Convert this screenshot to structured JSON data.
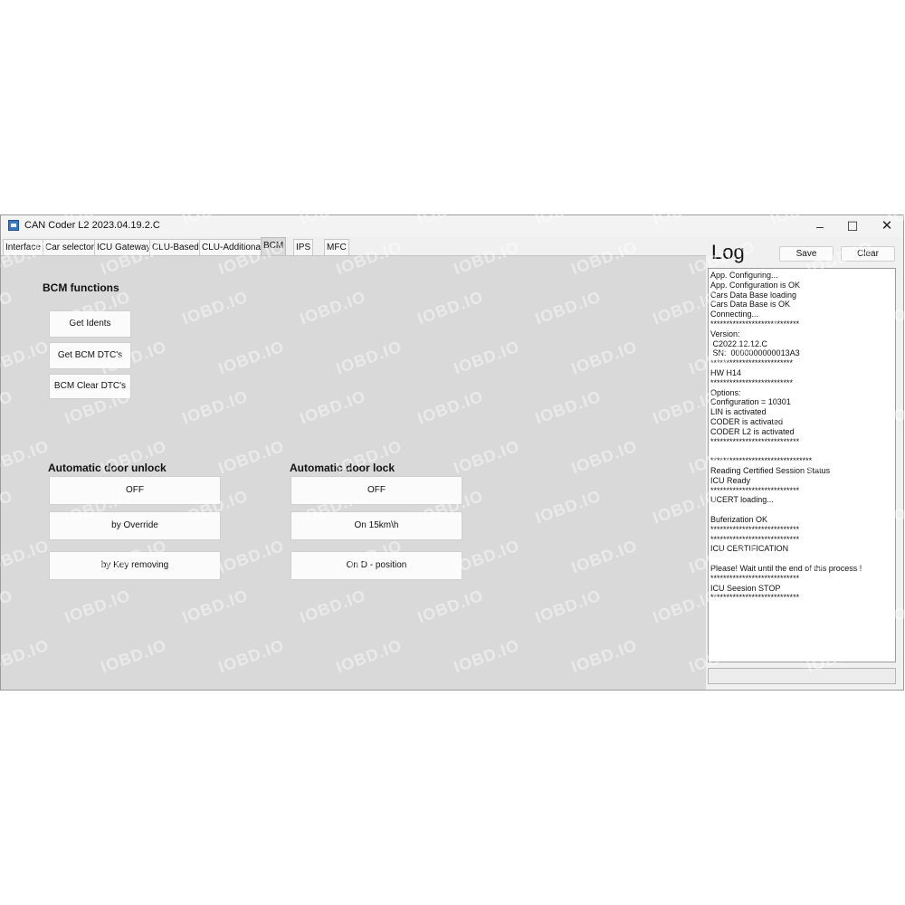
{
  "window": {
    "title": "CAN Coder L2 2023.04.19.2.C",
    "controls": {
      "minimize": "–",
      "maximize": "☐",
      "close": "✕"
    }
  },
  "tabs": [
    {
      "label": "Interface"
    },
    {
      "label": "Car selector"
    },
    {
      "label": "ICU Gateway"
    },
    {
      "label": "CLU-Based"
    },
    {
      "label": "CLU-Additional"
    },
    {
      "label": "BCM"
    },
    {
      "label": "IPS"
    },
    {
      "label": "MFC"
    }
  ],
  "active_tab": "BCM",
  "bcm": {
    "title": "BCM functions",
    "buttons": [
      "Get Idents",
      "Get BCM DTC's",
      "BCM Clear DTC's"
    ]
  },
  "door_unlock": {
    "title": "Automatic door unlock",
    "options": [
      "OFF",
      "by Override",
      "by Key removing"
    ]
  },
  "door_lock": {
    "title": "Automatic door lock",
    "options": [
      "OFF",
      "On 15km\\h",
      "On D - position"
    ]
  },
  "log": {
    "title": "Log",
    "save_label": "Save",
    "clear_label": "Clear",
    "lines": [
      "App. Configuring...",
      "App. Configuration is OK",
      "Cars Data Base loading",
      "Cars Data Base is OK",
      "Connecting...",
      "****************************",
      "Version:",
      " C2022.12.12.C",
      " SN:  0000000000013A3",
      "**************************",
      "HW H14",
      "**************************",
      "Options:",
      "Configuration = 10301",
      "LIN is activated",
      "CODER is activated",
      "CODER L2 is activated",
      "****************************",
      "",
      "********************************",
      "Reading Certified Session Status",
      "ICU Ready",
      "****************************",
      "UCERT loading...",
      "",
      "Buferization OK",
      "****************************",
      "****************************",
      "ICU CERTIFICATION",
      "",
      "Please! Wait until the end of this process !",
      "****************************",
      "ICU Seesion STOP",
      "****************************"
    ]
  },
  "watermark_text": "IOBD.IO"
}
